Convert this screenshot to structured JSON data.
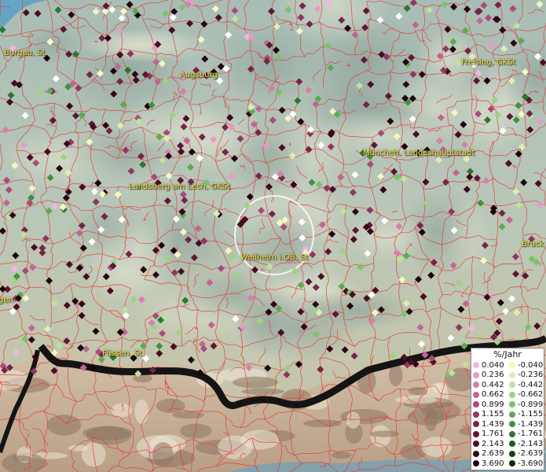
{
  "places": [
    {
      "name": "Burgau, St"
    },
    {
      "name": "Augsburg"
    },
    {
      "name": "Freising, GKSt"
    },
    {
      "name": "München, Landeshauptstadt"
    },
    {
      "name": "Landsberg am Lech, GKSt"
    },
    {
      "name": "Weilheim i.OB, St"
    },
    {
      "name": "Bruck"
    },
    {
      "name": "gen"
    },
    {
      "name": "Füssen, St"
    }
  ],
  "legend": {
    "title": "%/Jahr",
    "positive": [
      {
        "label": "0.040",
        "color": "#f3b6e4"
      },
      {
        "label": "0.236",
        "color": "#e89ac8"
      },
      {
        "label": "0.442",
        "color": "#d77fae"
      },
      {
        "label": "0.662",
        "color": "#c26593"
      },
      {
        "label": "0.899",
        "color": "#a84c79"
      },
      {
        "label": "1.155",
        "color": "#8f3761"
      },
      {
        "label": "1.439",
        "color": "#77244b"
      },
      {
        "label": "1.761",
        "color": "#5f1636"
      },
      {
        "label": "2.143",
        "color": "#4a0c25"
      },
      {
        "label": "2.639",
        "color": "#330617"
      },
      {
        "label": "3.690",
        "color": "#1c020a"
      }
    ],
    "negative": [
      {
        "label": "-0.040",
        "color": "#f3f7c4"
      },
      {
        "label": "-0.236",
        "color": "#dcefb0"
      },
      {
        "label": "-0.442",
        "color": "#bfe39a"
      },
      {
        "label": "-0.662",
        "color": "#9ed383"
      },
      {
        "label": "-0.899",
        "color": "#7cc26b"
      },
      {
        "label": "-1.155",
        "color": "#5aac52"
      },
      {
        "label": "-1.439",
        "color": "#3f923c"
      },
      {
        "label": "-1.761",
        "color": "#2a782c"
      },
      {
        "label": "-2.143",
        "color": "#1a5f1f"
      },
      {
        "label": "-2.639",
        "color": "#0f4414"
      },
      {
        "label": "-3.690",
        "color": "#062a0a"
      }
    ]
  },
  "colors": {
    "boundary": "#e03a3a",
    "border": "#141414",
    "lowland": "#b6c6bc",
    "alps": "#c8b8a0",
    "river": "#5aa0c8",
    "label": "#f2e23c",
    "highlight": "#ffffff"
  }
}
